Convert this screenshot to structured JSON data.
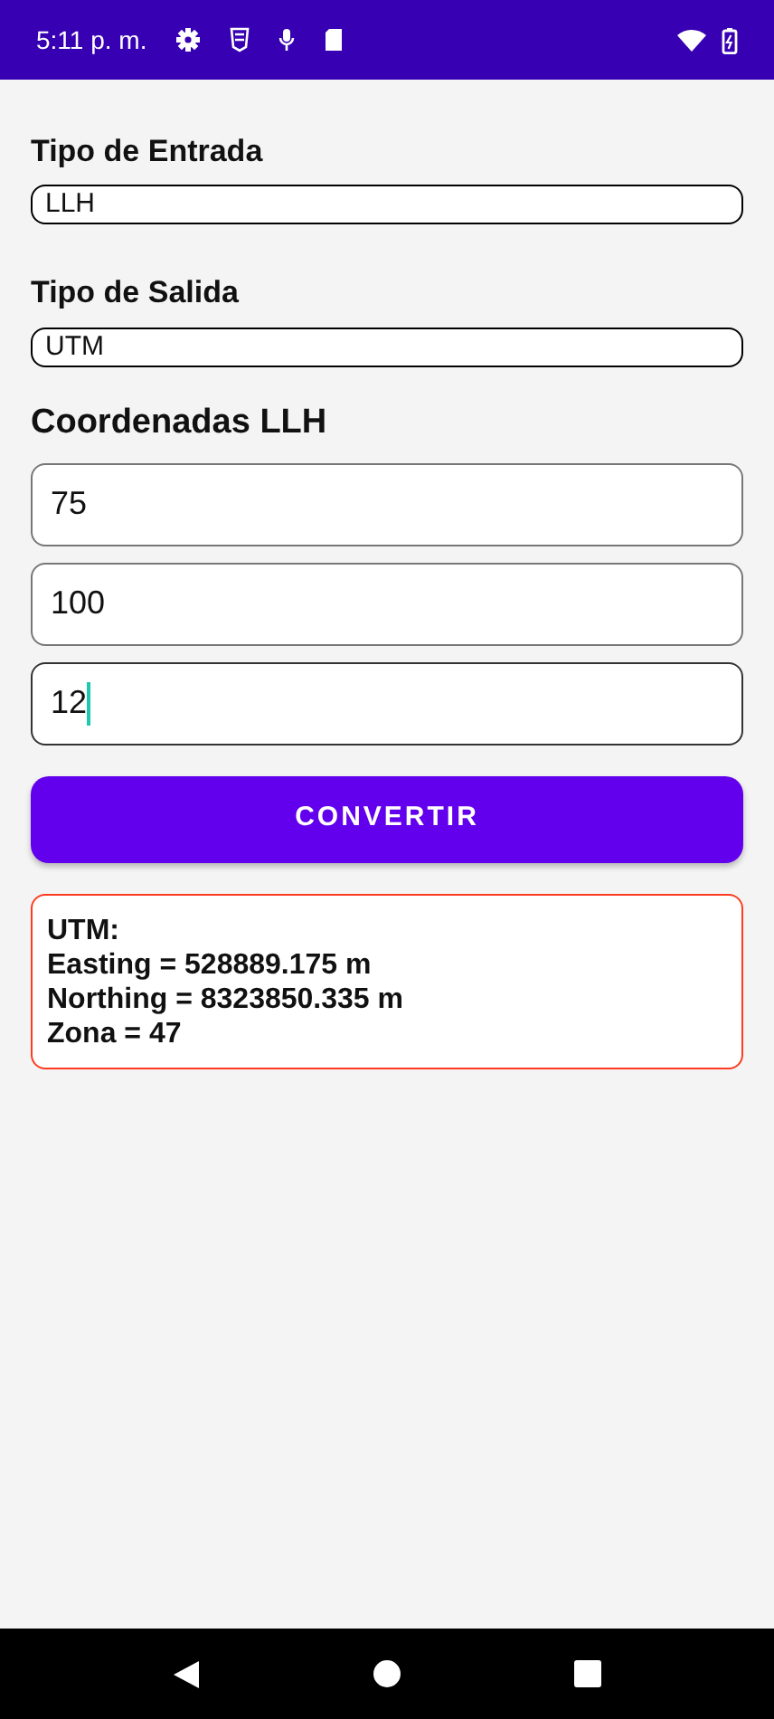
{
  "status_bar": {
    "time": "5:11 p. m."
  },
  "input_type": {
    "label": "Tipo de Entrada",
    "value": "LLH"
  },
  "output_type": {
    "label": "Tipo de Salida",
    "value": "UTM"
  },
  "coordinates": {
    "heading": "Coordenadas LLH",
    "fields": [
      {
        "value": "75",
        "focused": false
      },
      {
        "value": "100",
        "focused": false
      },
      {
        "value": "12",
        "focused": true
      }
    ]
  },
  "convert_button": "CONVERTIR",
  "result": {
    "lines": [
      "UTM:",
      "Easting = 528889.175 m",
      "Northing = 8323850.335 m",
      "Zona = 47"
    ]
  }
}
